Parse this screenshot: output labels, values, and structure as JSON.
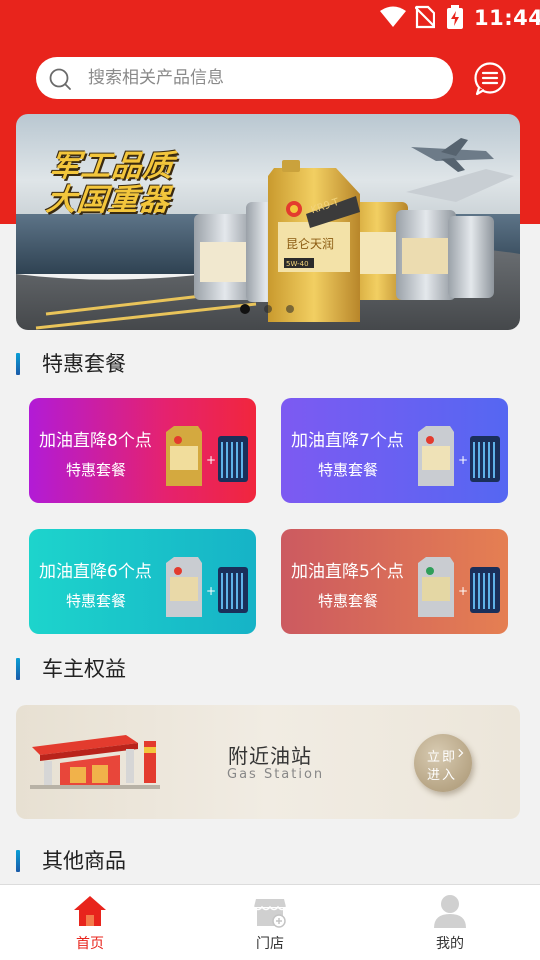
{
  "status_bar": {
    "time": "11:44",
    "icons": [
      "wifi-icon",
      "no-sim-icon",
      "battery-charging-icon"
    ]
  },
  "header": {
    "search": {
      "placeholder": "搜索相关产品信息",
      "value": "",
      "icon": "search-icon"
    },
    "message_icon": "message-icon",
    "accent_color": "#e8241c"
  },
  "banner": {
    "slogan_line1": "军工品质",
    "slogan_line2": "大国重器",
    "product_labels": [
      "昆仑天润",
      "KR9-T",
      "5W-40"
    ],
    "carousel": {
      "count": 3,
      "active": 0
    }
  },
  "sections": {
    "special": {
      "title": "特惠套餐"
    },
    "benefits": {
      "title": "车主权益"
    },
    "others": {
      "title": "其他商品"
    }
  },
  "packages": [
    {
      "title": "加油直降8个点",
      "subtitle": "特惠套餐"
    },
    {
      "title": "加油直降7个点",
      "subtitle": "特惠套餐"
    },
    {
      "title": "加油直降6个点",
      "subtitle": "特惠套餐"
    },
    {
      "title": "加油直降5个点",
      "subtitle": "特惠套餐"
    }
  ],
  "gas_station": {
    "title": "附近油站",
    "subtitle": "Gas Station",
    "enter_line1": "立即",
    "enter_line2": "进入"
  },
  "tabbar": {
    "active_color": "#e8241c",
    "items": [
      {
        "label": "首页",
        "icon": "home-icon",
        "active": true
      },
      {
        "label": "门店",
        "icon": "store-icon",
        "active": false
      },
      {
        "label": "我的",
        "icon": "profile-icon",
        "active": false
      }
    ]
  }
}
